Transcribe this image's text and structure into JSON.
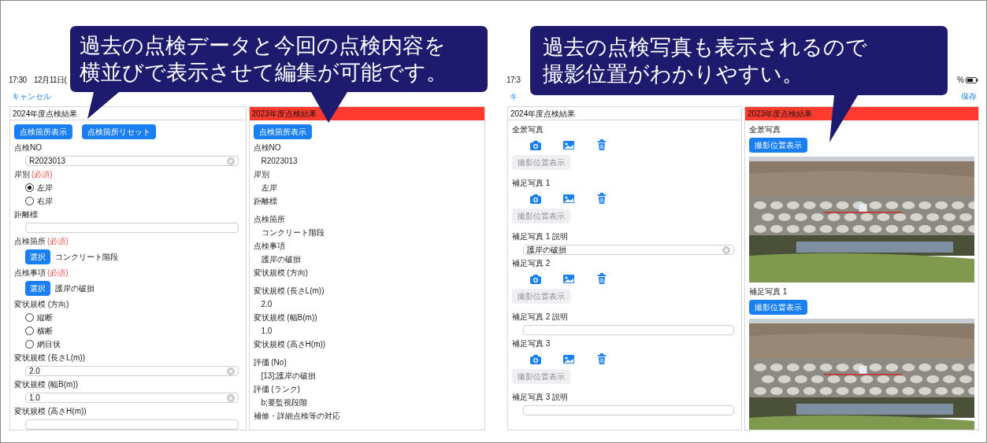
{
  "screens": [
    {
      "status": {
        "time": "17:30　12月11日("
      },
      "nav": {
        "cancel": "キャンセル"
      },
      "panels": [
        {
          "header": "2024年度点検結果",
          "current": true,
          "items": [
            {
              "kind": "buttons",
              "buttons": [
                {
                  "label": "点検箇所表示",
                  "disabled": false
                },
                {
                  "label": "点検箇所リセット",
                  "disabled": false
                }
              ]
            },
            {
              "kind": "label",
              "text": "点検NO"
            },
            {
              "kind": "input",
              "value": "R2023013"
            },
            {
              "kind": "label",
              "text": "岸別",
              "note": "(必須)"
            },
            {
              "kind": "radio",
              "label": "左岸",
              "selected": true
            },
            {
              "kind": "radio",
              "label": "右岸",
              "selected": false
            },
            {
              "kind": "label",
              "text": "距離標"
            },
            {
              "kind": "input"
            },
            {
              "kind": "label",
              "text": "点検箇所",
              "note": "(必須)"
            },
            {
              "kind": "select",
              "button": "選択",
              "value": "コンクリート階段"
            },
            {
              "kind": "label",
              "text": "点検事項",
              "note": "(必須)"
            },
            {
              "kind": "select",
              "button": "選択",
              "value": "護岸の破損"
            },
            {
              "kind": "label",
              "text": "変状規模 (方向)"
            },
            {
              "kind": "radio",
              "label": "縦断",
              "selected": false
            },
            {
              "kind": "radio",
              "label": "横断",
              "selected": false
            },
            {
              "kind": "radio",
              "label": "網目状",
              "selected": false
            },
            {
              "kind": "label",
              "text": "変状規模 (長さL(m))"
            },
            {
              "kind": "input",
              "value": "2.0"
            },
            {
              "kind": "label",
              "text": "変状規模 (幅B(m))"
            },
            {
              "kind": "input",
              "value": "1.0"
            },
            {
              "kind": "label",
              "text": "変状規模 (高さH(m))"
            },
            {
              "kind": "input"
            }
          ]
        },
        {
          "header": "2023年度点検結果",
          "current": false,
          "items": [
            {
              "kind": "buttons",
              "buttons": [
                {
                  "label": "点検箇所表示",
                  "disabled": false
                }
              ]
            },
            {
              "kind": "label",
              "text": "点検NO"
            },
            {
              "kind": "value",
              "text": "R2023013"
            },
            {
              "kind": "label",
              "text": "岸別"
            },
            {
              "kind": "value",
              "text": "左岸"
            },
            {
              "kind": "label",
              "text": "距離標"
            },
            {
              "kind": "spacer"
            },
            {
              "kind": "label",
              "text": "点検箇所"
            },
            {
              "kind": "value",
              "text": "コンクリート階段"
            },
            {
              "kind": "label",
              "text": "点検事項"
            },
            {
              "kind": "value",
              "text": "護岸の破損"
            },
            {
              "kind": "label",
              "text": "変状規模 (方向)"
            },
            {
              "kind": "spacer"
            },
            {
              "kind": "label",
              "text": "変状規模 (長さL(m))"
            },
            {
              "kind": "value",
              "text": "2.0"
            },
            {
              "kind": "label",
              "text": "変状規模 (幅B(m))"
            },
            {
              "kind": "value",
              "text": "1.0"
            },
            {
              "kind": "label",
              "text": "変状規模 (高さH(m))"
            },
            {
              "kind": "spacer"
            },
            {
              "kind": "label",
              "text": "評価 (No)"
            },
            {
              "kind": "value",
              "text": "[13];護岸の破損"
            },
            {
              "kind": "label",
              "text": "評価 (ランク)"
            },
            {
              "kind": "value",
              "text": "b;要監視段階"
            },
            {
              "kind": "label",
              "text": "補修・詳細点検等の対応"
            }
          ]
        }
      ]
    },
    {
      "status": {
        "time": "17:3",
        "battery": "%"
      },
      "nav": {
        "cancel": "キ",
        "save": "保存"
      },
      "panels": [
        {
          "header": "2024年度点検結果",
          "current": true,
          "items": [
            {
              "kind": "label",
              "text": "全景写真"
            },
            {
              "kind": "photo_actions"
            },
            {
              "kind": "buttons",
              "buttons": [
                {
                  "label": "撮影位置表示",
                  "disabled": true
                }
              ]
            },
            {
              "kind": "spacer"
            },
            {
              "kind": "label",
              "text": "補足写真 1"
            },
            {
              "kind": "photo_actions"
            },
            {
              "kind": "buttons",
              "buttons": [
                {
                  "label": "撮影位置表示",
                  "disabled": true
                }
              ]
            },
            {
              "kind": "spacer"
            },
            {
              "kind": "label",
              "text": "補足写真 1 説明"
            },
            {
              "kind": "input",
              "value": "護岸の破損"
            },
            {
              "kind": "label",
              "text": "補足写真 2"
            },
            {
              "kind": "photo_actions"
            },
            {
              "kind": "buttons",
              "buttons": [
                {
                  "label": "撮影位置表示",
                  "disabled": true
                }
              ]
            },
            {
              "kind": "spacer"
            },
            {
              "kind": "label",
              "text": "補足写真 2 説明"
            },
            {
              "kind": "input"
            },
            {
              "kind": "label",
              "text": "補足写真 3"
            },
            {
              "kind": "photo_actions"
            },
            {
              "kind": "buttons",
              "buttons": [
                {
                  "label": "撮影位置表示",
                  "disabled": true
                }
              ]
            },
            {
              "kind": "spacer"
            },
            {
              "kind": "label",
              "text": "補足写真 3 説明"
            },
            {
              "kind": "input"
            }
          ]
        },
        {
          "header": "2023年度点検結果",
          "current": false,
          "items": [
            {
              "kind": "label",
              "text": "全景写真"
            },
            {
              "kind": "buttons",
              "buttons": [
                {
                  "label": "撮影位置表示",
                  "disabled": false
                }
              ]
            },
            {
              "kind": "picture"
            },
            {
              "kind": "label",
              "text": "補足写真 1"
            },
            {
              "kind": "buttons",
              "buttons": [
                {
                  "label": "撮影位置表示",
                  "disabled": false
                }
              ]
            },
            {
              "kind": "picture"
            }
          ]
        }
      ]
    }
  ],
  "callouts": [
    {
      "lines": [
        "過去の点検データと今回の点検内容を",
        "横並びで表示させて編集が可能です。"
      ]
    },
    {
      "lines": [
        "過去の点検写真も表示されるので",
        "撮影位置がわかりやすい。"
      ]
    }
  ]
}
